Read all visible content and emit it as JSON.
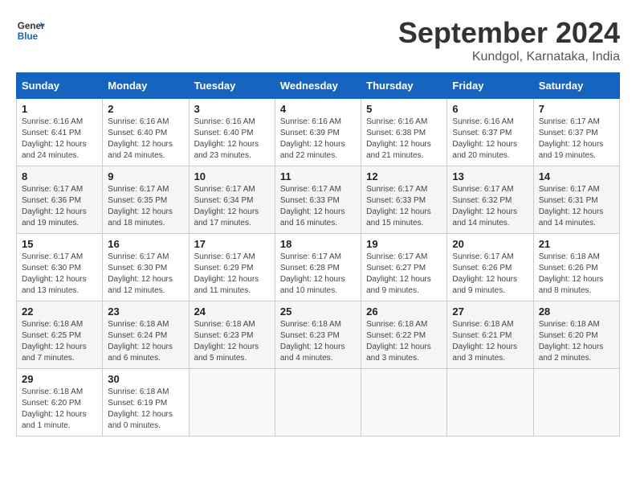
{
  "logo": {
    "line1": "General",
    "line2": "Blue"
  },
  "title": "September 2024",
  "location": "Kundgol, Karnataka, India",
  "days_of_week": [
    "Sunday",
    "Monday",
    "Tuesday",
    "Wednesday",
    "Thursday",
    "Friday",
    "Saturday"
  ],
  "weeks": [
    [
      {
        "day": "1",
        "detail": "Sunrise: 6:16 AM\nSunset: 6:41 PM\nDaylight: 12 hours\nand 24 minutes."
      },
      {
        "day": "2",
        "detail": "Sunrise: 6:16 AM\nSunset: 6:40 PM\nDaylight: 12 hours\nand 24 minutes."
      },
      {
        "day": "3",
        "detail": "Sunrise: 6:16 AM\nSunset: 6:40 PM\nDaylight: 12 hours\nand 23 minutes."
      },
      {
        "day": "4",
        "detail": "Sunrise: 6:16 AM\nSunset: 6:39 PM\nDaylight: 12 hours\nand 22 minutes."
      },
      {
        "day": "5",
        "detail": "Sunrise: 6:16 AM\nSunset: 6:38 PM\nDaylight: 12 hours\nand 21 minutes."
      },
      {
        "day": "6",
        "detail": "Sunrise: 6:16 AM\nSunset: 6:37 PM\nDaylight: 12 hours\nand 20 minutes."
      },
      {
        "day": "7",
        "detail": "Sunrise: 6:17 AM\nSunset: 6:37 PM\nDaylight: 12 hours\nand 19 minutes."
      }
    ],
    [
      {
        "day": "8",
        "detail": "Sunrise: 6:17 AM\nSunset: 6:36 PM\nDaylight: 12 hours\nand 19 minutes."
      },
      {
        "day": "9",
        "detail": "Sunrise: 6:17 AM\nSunset: 6:35 PM\nDaylight: 12 hours\nand 18 minutes."
      },
      {
        "day": "10",
        "detail": "Sunrise: 6:17 AM\nSunset: 6:34 PM\nDaylight: 12 hours\nand 17 minutes."
      },
      {
        "day": "11",
        "detail": "Sunrise: 6:17 AM\nSunset: 6:33 PM\nDaylight: 12 hours\nand 16 minutes."
      },
      {
        "day": "12",
        "detail": "Sunrise: 6:17 AM\nSunset: 6:33 PM\nDaylight: 12 hours\nand 15 minutes."
      },
      {
        "day": "13",
        "detail": "Sunrise: 6:17 AM\nSunset: 6:32 PM\nDaylight: 12 hours\nand 14 minutes."
      },
      {
        "day": "14",
        "detail": "Sunrise: 6:17 AM\nSunset: 6:31 PM\nDaylight: 12 hours\nand 14 minutes."
      }
    ],
    [
      {
        "day": "15",
        "detail": "Sunrise: 6:17 AM\nSunset: 6:30 PM\nDaylight: 12 hours\nand 13 minutes."
      },
      {
        "day": "16",
        "detail": "Sunrise: 6:17 AM\nSunset: 6:30 PM\nDaylight: 12 hours\nand 12 minutes."
      },
      {
        "day": "17",
        "detail": "Sunrise: 6:17 AM\nSunset: 6:29 PM\nDaylight: 12 hours\nand 11 minutes."
      },
      {
        "day": "18",
        "detail": "Sunrise: 6:17 AM\nSunset: 6:28 PM\nDaylight: 12 hours\nand 10 minutes."
      },
      {
        "day": "19",
        "detail": "Sunrise: 6:17 AM\nSunset: 6:27 PM\nDaylight: 12 hours\nand 9 minutes."
      },
      {
        "day": "20",
        "detail": "Sunrise: 6:17 AM\nSunset: 6:26 PM\nDaylight: 12 hours\nand 9 minutes."
      },
      {
        "day": "21",
        "detail": "Sunrise: 6:18 AM\nSunset: 6:26 PM\nDaylight: 12 hours\nand 8 minutes."
      }
    ],
    [
      {
        "day": "22",
        "detail": "Sunrise: 6:18 AM\nSunset: 6:25 PM\nDaylight: 12 hours\nand 7 minutes."
      },
      {
        "day": "23",
        "detail": "Sunrise: 6:18 AM\nSunset: 6:24 PM\nDaylight: 12 hours\nand 6 minutes."
      },
      {
        "day": "24",
        "detail": "Sunrise: 6:18 AM\nSunset: 6:23 PM\nDaylight: 12 hours\nand 5 minutes."
      },
      {
        "day": "25",
        "detail": "Sunrise: 6:18 AM\nSunset: 6:23 PM\nDaylight: 12 hours\nand 4 minutes."
      },
      {
        "day": "26",
        "detail": "Sunrise: 6:18 AM\nSunset: 6:22 PM\nDaylight: 12 hours\nand 3 minutes."
      },
      {
        "day": "27",
        "detail": "Sunrise: 6:18 AM\nSunset: 6:21 PM\nDaylight: 12 hours\nand 3 minutes."
      },
      {
        "day": "28",
        "detail": "Sunrise: 6:18 AM\nSunset: 6:20 PM\nDaylight: 12 hours\nand 2 minutes."
      }
    ],
    [
      {
        "day": "29",
        "detail": "Sunrise: 6:18 AM\nSunset: 6:20 PM\nDaylight: 12 hours\nand 1 minute."
      },
      {
        "day": "30",
        "detail": "Sunrise: 6:18 AM\nSunset: 6:19 PM\nDaylight: 12 hours\nand 0 minutes."
      },
      {
        "day": "",
        "detail": ""
      },
      {
        "day": "",
        "detail": ""
      },
      {
        "day": "",
        "detail": ""
      },
      {
        "day": "",
        "detail": ""
      },
      {
        "day": "",
        "detail": ""
      }
    ]
  ]
}
